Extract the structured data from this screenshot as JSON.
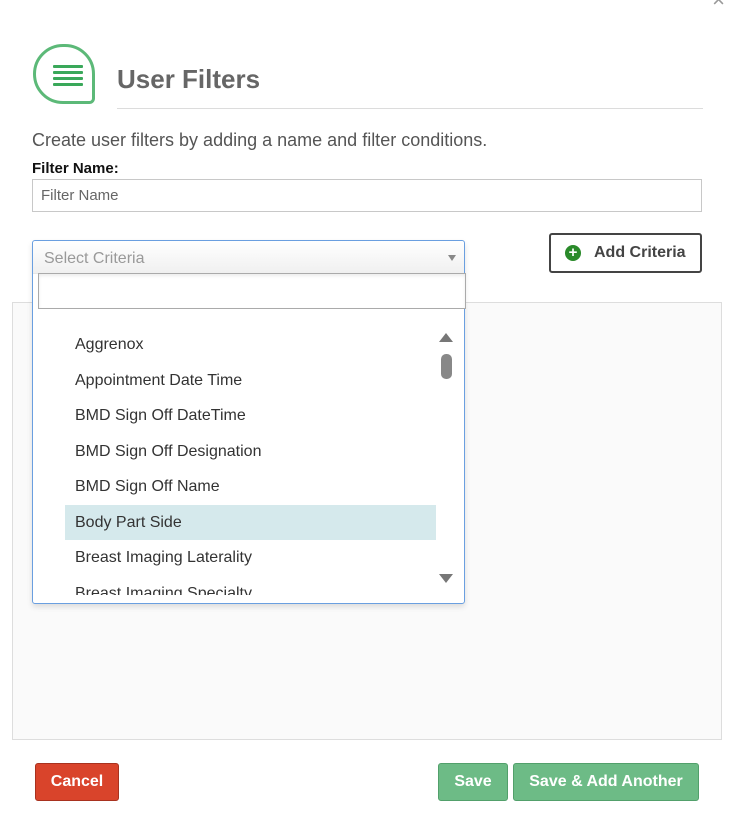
{
  "dialog": {
    "close_icon": "×",
    "icon": "list-icon",
    "title": "User Filters",
    "description": "Create user filters by adding a name and filter conditions."
  },
  "filter_name": {
    "label": "Filter Name:",
    "placeholder": "Filter Name",
    "value": ""
  },
  "criteria_select": {
    "placeholder": "Select Criteria",
    "search_value": "",
    "options": [
      "Aggrenox",
      "Appointment Date Time",
      "BMD Sign Off DateTime",
      "BMD Sign Off Designation",
      "BMD Sign Off Name",
      "Body Part Side",
      "Breast Imaging Laterality",
      "Breast Imaging Specialty"
    ],
    "highlighted": "Body Part Side"
  },
  "add_criteria": {
    "label": "Add Criteria",
    "icon": "plus-circle-icon",
    "icon_color": "#2a8a2a"
  },
  "footer": {
    "cancel_label": "Cancel",
    "save_label": "Save",
    "save_add_label": "Save & Add Another"
  },
  "colors": {
    "brand_green": "#5cb978",
    "cancel_red": "#d9442b",
    "save_green": "#6dbb86",
    "highlight": "#d5e9ec"
  }
}
